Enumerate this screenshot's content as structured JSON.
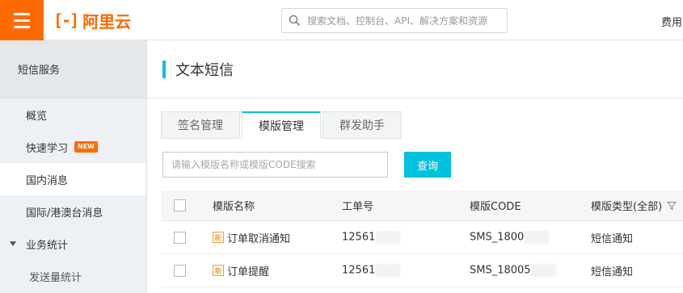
{
  "header": {
    "logo_text": "阿里云",
    "search_placeholder": "搜索文档、控制台、API、解决方案和资源",
    "right_label": "费用"
  },
  "sidebar": {
    "title": "短信服务",
    "items": [
      {
        "label": "概览"
      },
      {
        "label": "快速学习",
        "badge": "NEW"
      },
      {
        "label": "国内消息"
      },
      {
        "label": "国际/港澳台消息"
      }
    ],
    "group": {
      "label": "业务统计",
      "children": [
        {
          "label": "发送量统计"
        }
      ]
    }
  },
  "page": {
    "title": "文本短信",
    "tabs": [
      {
        "label": "签名管理"
      },
      {
        "label": "模版管理"
      },
      {
        "label": "群发助手"
      }
    ],
    "filter": {
      "placeholder": "请输入模版名称或模版CODE搜索",
      "button": "查询"
    },
    "table": {
      "columns": [
        "模版名称",
        "工单号",
        "模版CODE",
        "模版类型(全部)"
      ],
      "rows": [
        {
          "tag": "新",
          "name": "订单取消通知",
          "order": "12561",
          "code": "SMS_1800",
          "type": "短信通知"
        },
        {
          "tag": "新",
          "name": "订单提醒",
          "order": "12561",
          "code": "SMS_18005",
          "type": "短信通知"
        }
      ]
    }
  }
}
